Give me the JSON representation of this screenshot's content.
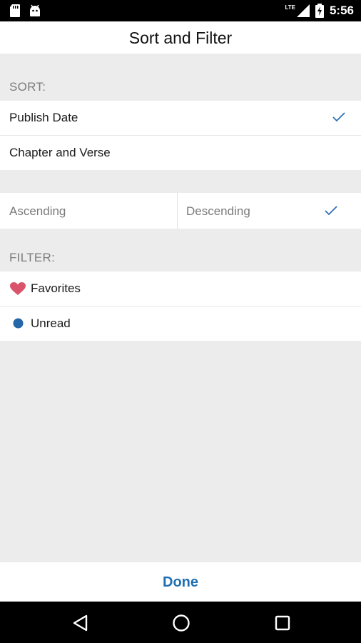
{
  "status_bar": {
    "network": "LTE",
    "time": "5:56"
  },
  "header": {
    "title": "Sort and Filter"
  },
  "sort": {
    "section_label": "SORT:",
    "options": [
      {
        "label": "Publish Date",
        "selected": true
      },
      {
        "label": "Chapter and Verse",
        "selected": false
      }
    ],
    "order": {
      "ascending": "Ascending",
      "descending": "Descending",
      "selected": "Descending"
    }
  },
  "filter": {
    "section_label": "FILTER:",
    "options": [
      {
        "label": "Favorites",
        "icon": "heart-icon",
        "color": "#d9546a"
      },
      {
        "label": "Unread",
        "icon": "dot-icon",
        "color": "#2566a8"
      }
    ]
  },
  "footer": {
    "done_label": "Done"
  },
  "colors": {
    "accent": "#1f6fb2",
    "check": "#2f6fb5",
    "background": "#ececec"
  }
}
